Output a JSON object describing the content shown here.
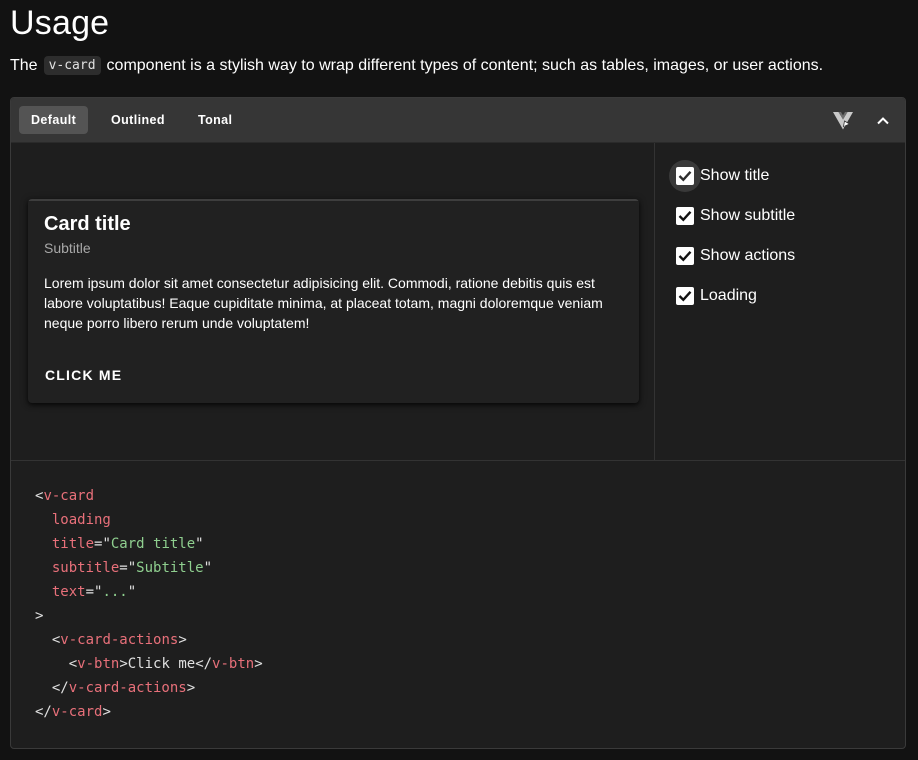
{
  "heading": "Usage",
  "intro": {
    "before": "The",
    "code": "v-card",
    "after": "component is a stylish way to wrap different types of content; such as tables, images, or user actions."
  },
  "toolbar": {
    "tabs": [
      {
        "label": "Default",
        "active": true
      },
      {
        "label": "Outlined",
        "active": false
      },
      {
        "label": "Tonal",
        "active": false
      }
    ],
    "icons": [
      "vue-icon",
      "chevron-up-icon"
    ]
  },
  "card": {
    "title": "Card title",
    "subtitle": "Subtitle",
    "text": "Lorem ipsum dolor sit amet consectetur adipisicing elit. Commodi, ratione debitis quis est labore voluptatibus! Eaque cupiditate minima, at placeat totam, magni doloremque veniam neque porro libero rerum unde voluptatem!",
    "action_label": "CLICK ME"
  },
  "options": [
    {
      "label": "Show title",
      "checked": true
    },
    {
      "label": "Show subtitle",
      "checked": true
    },
    {
      "label": "Show actions",
      "checked": true
    },
    {
      "label": "Loading",
      "checked": true
    }
  ],
  "code": {
    "l1_tag": "v-card",
    "l2_attr": "loading",
    "l3_attr": "title",
    "l3_val": "Card title",
    "l4_attr": "subtitle",
    "l4_val": "Subtitle",
    "l5_attr": "text",
    "l5_val": "...",
    "l7_tag": "v-card-actions",
    "l8_tag": "v-btn",
    "l8_text": "Click me",
    "l8_close": "v-btn",
    "l9_tag": "v-card-actions",
    "l10_tag": "v-card"
  },
  "colors": {
    "background": "#121212",
    "panel": "#1e1e1e",
    "toolbar": "#363636",
    "code_tag": "#e8707a",
    "code_string": "#8fcf8f"
  }
}
